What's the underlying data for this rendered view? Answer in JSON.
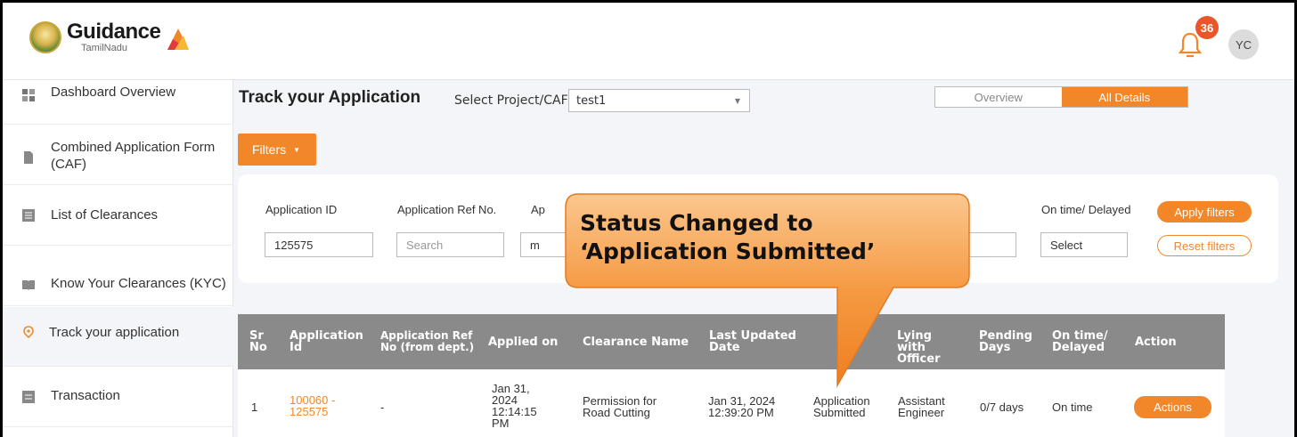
{
  "brand": {
    "name": "Guidance",
    "sub": "TamilNadu"
  },
  "header": {
    "notification_count": "36",
    "avatar_initials": "YC"
  },
  "sidebar": {
    "items": [
      {
        "label": "Dashboard Overview",
        "icon": "dashboard-icon"
      },
      {
        "label": "Combined Application Form (CAF)",
        "icon": "document-icon"
      },
      {
        "label": "List of Clearances",
        "icon": "list-icon"
      },
      {
        "label": "Know Your Clearances (KYC)",
        "icon": "book-icon"
      },
      {
        "label": "Track your application",
        "icon": "location-pin-icon"
      },
      {
        "label": "Transaction",
        "icon": "receipt-icon"
      }
    ]
  },
  "main": {
    "title": "Track your Application",
    "select_label": "Select Project/CAF",
    "select_value": "test1",
    "view_toggle": {
      "overview": "Overview",
      "all_details": "All Details",
      "active": "All Details"
    }
  },
  "filters": {
    "button_label": "Filters",
    "application_id": {
      "label": "Application ID",
      "value": "125575"
    },
    "application_ref": {
      "label": "Application Ref No.",
      "placeholder": "Search"
    },
    "applied_partial": {
      "label": "Ap",
      "value": "m"
    },
    "on_time_delayed": {
      "label": "On time/ Delayed",
      "value": "Select"
    },
    "apply_label": "Apply filters",
    "reset_label": "Reset filters"
  },
  "table": {
    "headers": {
      "sr": "Sr No",
      "app_id": "Application Id",
      "app_ref": "Application Ref No (from dept.)",
      "applied_on": "Applied on",
      "clearance_name": "Clearance Name",
      "last_updated": "Last Updated Date",
      "lying_with": "Lying with Officer",
      "pending_days": "Pending Days",
      "on_time": "On time/ Delayed",
      "action": "Action"
    },
    "rows": [
      {
        "sr": "1",
        "app_id": "100060 - 125575",
        "app_ref": "-",
        "applied_on": "Jan 31, 2024 12:14:15 PM",
        "clearance_name": "Permission for Road Cutting",
        "last_updated": "Jan 31, 2024 12:39:20 PM",
        "status": "Application Submitted",
        "lying_with": "Assistant Engineer",
        "pending_days": "0/7 days",
        "on_time": "On time",
        "action_label": "Actions"
      }
    ]
  },
  "callout": {
    "line1": "Status Changed to",
    "line2": "‘Application Submitted’"
  },
  "colors": {
    "accent": "#f2872a",
    "badge": "#e8562a",
    "table_header": "#8a8a8a"
  }
}
